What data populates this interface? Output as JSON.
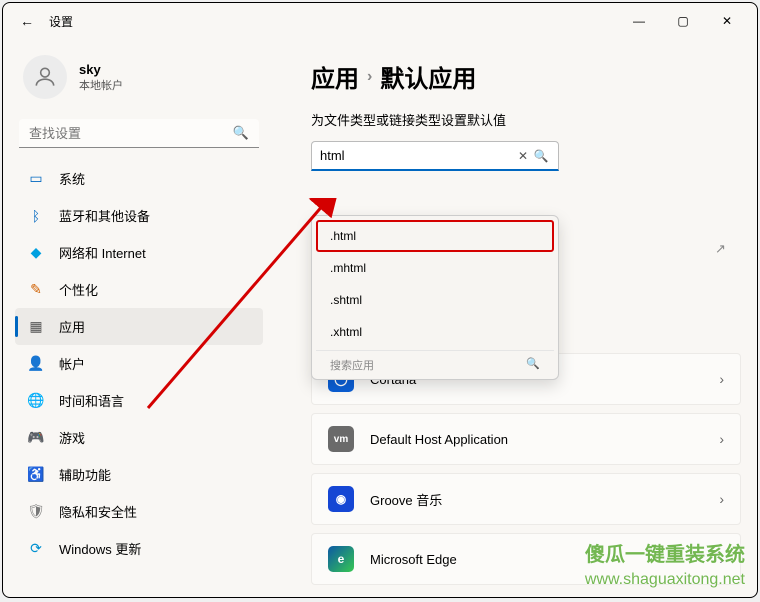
{
  "window": {
    "title": "设置",
    "minimize": "—",
    "maximize": "▢",
    "close": "✕",
    "back": "←"
  },
  "profile": {
    "name": "sky",
    "type": "本地帐户"
  },
  "sidebar_search": {
    "placeholder": "查找设置"
  },
  "nav": [
    {
      "label": "系统"
    },
    {
      "label": "蓝牙和其他设备"
    },
    {
      "label": "网络和 Internet"
    },
    {
      "label": "个性化"
    },
    {
      "label": "应用"
    },
    {
      "label": "帐户"
    },
    {
      "label": "时间和语言"
    },
    {
      "label": "游戏"
    },
    {
      "label": "辅助功能"
    },
    {
      "label": "隐私和安全性"
    },
    {
      "label": "Windows 更新"
    }
  ],
  "breadcrumb": {
    "a": "应用",
    "sep": "›",
    "b": "默认应用"
  },
  "subtitle": "为文件类型或链接类型设置默认值",
  "type_search": {
    "value": "html",
    "clear": "✕",
    "go": "🔍"
  },
  "dropdown": {
    "items": [
      ".html",
      ".mhtml",
      ".shtml",
      ".xhtml"
    ],
    "footer": "搜索应用"
  },
  "apps": [
    {
      "name": "Cortana",
      "bg": "#0a5fd6",
      "glyph": "◯"
    },
    {
      "name": "Default Host Application",
      "bg": "#6a6a6a",
      "glyph": "vm"
    },
    {
      "name": "Groove 音乐",
      "bg": "#1546d4",
      "glyph": "◉"
    },
    {
      "name": "Microsoft Edge",
      "bg": "#ffffff",
      "glyph": "e"
    }
  ],
  "watermark": {
    "line1": "傻瓜一键重装系统",
    "line2": "www.shaguaxitong.net"
  }
}
